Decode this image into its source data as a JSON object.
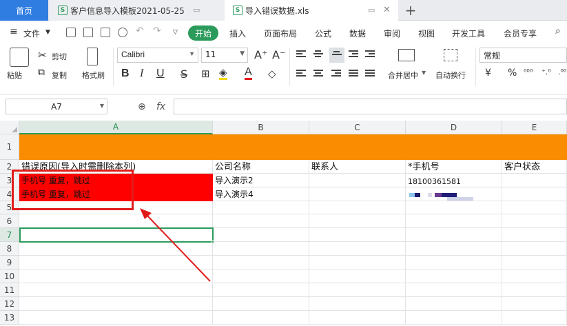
{
  "tabs": {
    "home": "首页",
    "file1": "客户信息导入模板2021-05-25",
    "file2": "导入错误数据.xls",
    "file_icon": "S",
    "new_tab": "+"
  },
  "menu": {
    "file": "文件",
    "start": "开始",
    "items": [
      "插入",
      "页面布局",
      "公式",
      "数据",
      "审阅",
      "视图",
      "开发工具",
      "会员专享"
    ]
  },
  "ribbon": {
    "paste": "粘贴",
    "cut": "剪切",
    "copy": "复制",
    "format_painter": "格式刷",
    "font": "Calibri",
    "size": "11",
    "merge": "合并居中",
    "wrap": "自动换行",
    "number_format": "常规",
    "bold": "B",
    "italic": "I",
    "underline": "U",
    "currency": "¥",
    "percent": "%"
  },
  "formula_bar": {
    "name_box": "A7",
    "fx": "fx",
    "formula": ""
  },
  "sheet": {
    "columns": [
      "A",
      "B",
      "C",
      "D",
      "E"
    ],
    "rows": [
      "1",
      "2",
      "3",
      "4",
      "5",
      "6",
      "7",
      "8",
      "9",
      "10",
      "11",
      "12",
      "13"
    ],
    "headers": {
      "a": "错误原因(导入时需删除本列)",
      "b": "公司名称",
      "c": "联系人",
      "d": "*手机号",
      "e": "客户状态"
    },
    "row3": {
      "a": "手机号 重复，跳过",
      "b": "导入演示2",
      "d": "18100361581"
    },
    "row4": {
      "a": "手机号 重复，跳过",
      "b": "导入演示4"
    }
  },
  "colors": {
    "accent": "#2b9b5b",
    "home_tab": "#2f7de1",
    "title_row": "#f98c00",
    "error_fill": "#ff0000",
    "annotation": "#e11b1b"
  },
  "icons": [
    "menu-icon",
    "save-icon",
    "print-icon",
    "undo-icon",
    "redo-icon",
    "search-icon",
    "zoom-icon",
    "arrow-annotation"
  ]
}
